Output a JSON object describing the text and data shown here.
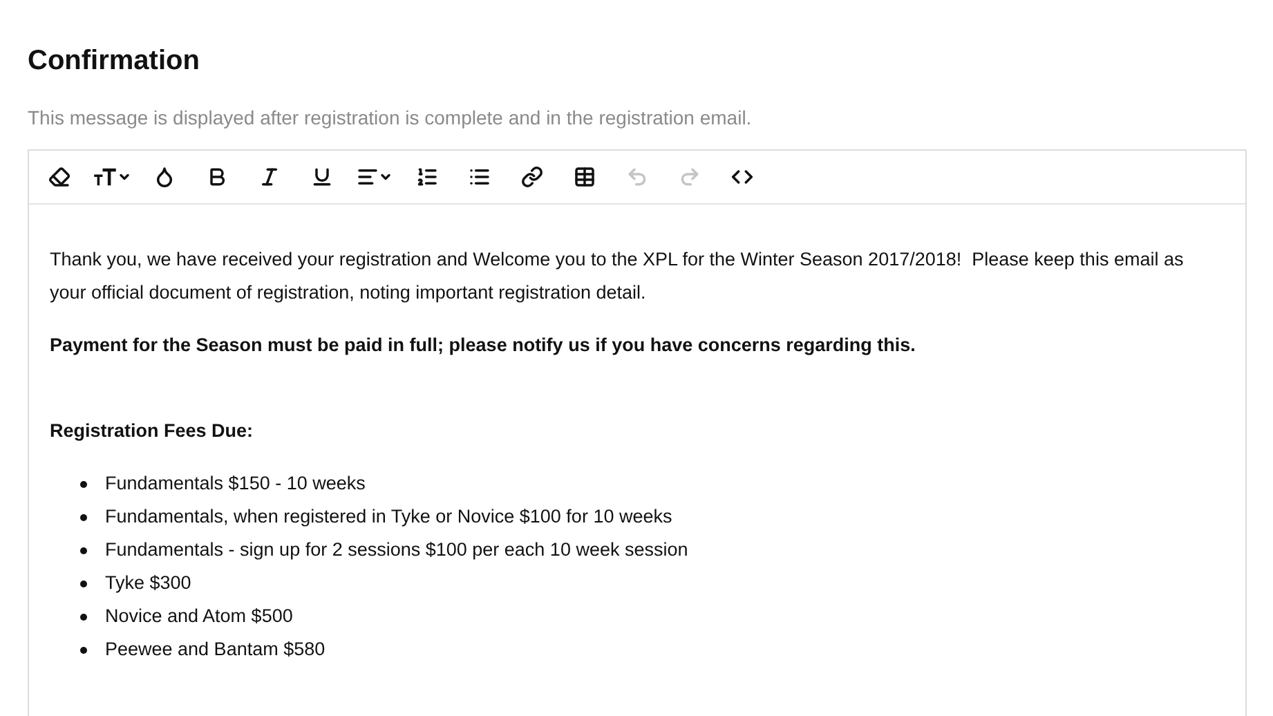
{
  "title": "Confirmation",
  "description": "This message is displayed after registration is complete and in the registration email.",
  "toolbar": [
    {
      "kind": "eraser",
      "has_menu": false,
      "disabled": false
    },
    {
      "kind": "font-size",
      "has_menu": true,
      "disabled": false
    },
    {
      "kind": "color",
      "has_menu": false,
      "disabled": false
    },
    {
      "kind": "bold",
      "has_menu": false,
      "disabled": false
    },
    {
      "kind": "italic",
      "has_menu": false,
      "disabled": false
    },
    {
      "kind": "underline",
      "has_menu": false,
      "disabled": false
    },
    {
      "kind": "align",
      "has_menu": true,
      "disabled": false
    },
    {
      "kind": "ordered-list",
      "has_menu": false,
      "disabled": false
    },
    {
      "kind": "bullet-list",
      "has_menu": false,
      "disabled": false
    },
    {
      "kind": "link",
      "has_menu": false,
      "disabled": false
    },
    {
      "kind": "table",
      "has_menu": false,
      "disabled": false
    },
    {
      "kind": "undo",
      "has_menu": false,
      "disabled": true
    },
    {
      "kind": "redo",
      "has_menu": false,
      "disabled": true
    },
    {
      "kind": "code",
      "has_menu": false,
      "disabled": false
    }
  ],
  "content": [
    {
      "kind": "paragraph",
      "text": "Thank you, we have received your registration and Welcome you to the XPL for the Winter Season 2017/2018!  Please keep this email as your official document of registration, noting important registration detail."
    },
    {
      "kind": "bold",
      "text": "Payment for the Season must be paid in full; please notify us if you have concerns regarding this."
    },
    {
      "kind": "heading",
      "text": "Registration Fees Due:"
    },
    {
      "kind": "list",
      "items": [
        "Fundamentals $150 - 10 weeks",
        "Fundamentals, when registered in Tyke or Novice $100 for 10 weeks",
        "Fundamentals - sign up for 2 sessions $100 per each 10 week session",
        "Tyke $300",
        "Novice and Atom $500",
        "Peewee and Bantam $580"
      ]
    }
  ]
}
